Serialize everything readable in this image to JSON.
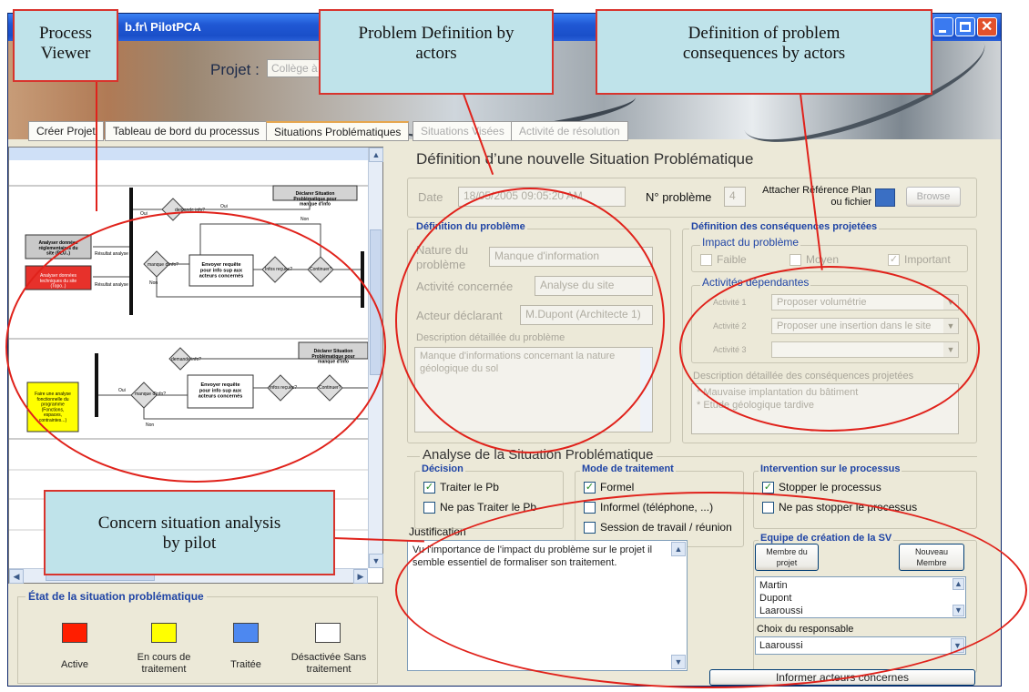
{
  "window": {
    "title": "b.fr\\ PilotPCA"
  },
  "header": {
    "projet_label": "Projet :",
    "projet_value": "Collège à C"
  },
  "tabs": [
    {
      "label": "Créer Projet"
    },
    {
      "label": "Tableau de bord du processus"
    },
    {
      "label": "Situations Problématiques"
    },
    {
      "label": "Situations Visées"
    },
    {
      "label": "Activité de résolution"
    }
  ],
  "diagram": {
    "top": {
      "b1": "Analyser données réglementaires du site (PLU..)",
      "b2": "Analyser données techniques du site (Topo..)",
      "d1": "demande info?",
      "d2": "manque d'info?",
      "d3": "Infos reçues?",
      "d4": "Continuer?",
      "req": "Envoyer requête pour info sup aux acteurs concernés",
      "decl": "Déclarer Situation Problématique pour manque d'info",
      "res": "Résultat analyse",
      "oui": "Oui",
      "non": "Non"
    },
    "bottom": {
      "yellow": "Faire une analyse fonctionnelle du programme (Fonctions, espaces, contraintes...)",
      "decl": "Déclarer Situation Problématique pour manque d'info"
    }
  },
  "legend": {
    "title": "État de la situation problématique",
    "items": [
      {
        "label": "Active",
        "color": "#ff1e00"
      },
      {
        "label": "En cours de traitement",
        "color": "#ffff00"
      },
      {
        "label": "Traitée",
        "color": "#4d88f0"
      },
      {
        "label": "Désactivée Sans traitement",
        "color": "#ffffff"
      }
    ]
  },
  "form": {
    "heading": "Définition d’une nouvelle Situation Problématique",
    "date_label": "Date",
    "date_value": "18/05/2005 09:05:20 AM",
    "num_label": "N° problème",
    "num_value": "4",
    "attach_label": "Attacher Référence Plan ou fichier",
    "browse": "Browse",
    "def": {
      "title": "Définition du problème",
      "nature_label": "Nature du problème",
      "nature_value": "Manque d'information",
      "activite_label": "Activité concernée",
      "activite_value": "Analyse du site",
      "acteur_label": "Acteur déclarant",
      "acteur_value": "M.Dupont (Architecte 1)",
      "desc_label": "Description détaillée du problème",
      "desc_value": "Manque d'informations concernant la nature géologique du sol"
    },
    "cons": {
      "title": "Définition des conséquences projetées",
      "impact_title": "Impact du problème",
      "faible": "Faible",
      "moyen": "Moyen",
      "important": "Important",
      "act_title": "Activités dépendantes",
      "act1_label": "Activité 1",
      "act1_value": "Proposer volumétrie",
      "act2_label": "Activité 2",
      "act2_value": "Proposer une insertion dans le site",
      "act3_label": "Activité 3",
      "act3_value": "",
      "desc_label": "Description détaillée des conséquences projetées",
      "desc_line1": "* Mauvaise implantation du bâtiment",
      "desc_line2": "* Etude géologique tardive"
    }
  },
  "analysis": {
    "heading": "Analyse de la Situation Problématique",
    "decision_title": "Décision",
    "traiter": "Traiter le Pb",
    "ne_pas_traiter": "Ne pas Traiter le Pb",
    "mode_title": "Mode de traitement",
    "formel": "Formel",
    "informel": "Informel (téléphone, ...)",
    "session": "Session de travail / réunion",
    "intervention_title": "Intervention sur le processus",
    "stopper": "Stopper le processus",
    "ne_pas_stopper": "Ne pas stopper le processus",
    "equipe_title": "Equipe de création de la SV",
    "membre_projet": "Membre du projet",
    "nouveau_membre": "Nouveau Membre",
    "members": [
      "Martin",
      "Dupont",
      "Laaroussi"
    ],
    "justif_label": "Justification",
    "justif_value": "Vu l'importance de l'impact du problème sur le projet il semble essentiel de formaliser son traitement.",
    "choix_label": "Choix du responsable",
    "choix_value": "Laaroussi",
    "informer": "Informer acteurs concernes"
  },
  "callouts": {
    "process_viewer": "Process Viewer",
    "problem_def": "Problem Definition by actors",
    "consequences": "Definition of problem consequences by actors",
    "concern": "Concern situation analysis by pilot"
  },
  "colors": {
    "annotation_red": "#e0221b",
    "callout_fill": "#bfe3ea",
    "group_blue": "#1f44a5"
  }
}
